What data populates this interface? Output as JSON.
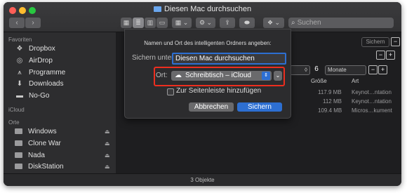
{
  "window": {
    "title": "Diesen Mac durchsuchen",
    "status": "3 Objekte"
  },
  "toolbar": {
    "back": "‹",
    "forward": "›",
    "view_icon": "▦",
    "view_list": "≣",
    "view_columns": "▥",
    "view_gallery": "▭",
    "group": "▦ ⌄",
    "action": "⚙ ⌄",
    "share": "⇪",
    "tag": "⬬",
    "dropbox": "❖ ⌄",
    "search_placeholder": "Suchen",
    "search_icon_glyph": "⌕"
  },
  "sidebar": {
    "favorites_heading": "Favoriten",
    "favorites": [
      {
        "label": "Dropbox",
        "icon": "dropbox-icon",
        "glyph": "❖"
      },
      {
        "label": "AirDrop",
        "icon": "airdrop-icon",
        "glyph": "◎"
      },
      {
        "label": "Programme",
        "icon": "applications-icon",
        "glyph": "⩚"
      },
      {
        "label": "Downloads",
        "icon": "downloads-icon",
        "glyph": "⬇"
      },
      {
        "label": "No-Go",
        "icon": "folder-icon",
        "glyph": "▬"
      }
    ],
    "icloud_heading": "iCloud",
    "orte_heading": "Orte",
    "orte": [
      {
        "label": "Windows",
        "icon": "disk-icon"
      },
      {
        "label": "Clone War",
        "icon": "disk-icon"
      },
      {
        "label": "Nada",
        "icon": "disk-icon"
      },
      {
        "label": "DiskStation",
        "icon": "server-icon"
      }
    ],
    "eject_glyph": "⏏"
  },
  "search_bar": {
    "save_button": "Sichern",
    "minus": "−",
    "plus": "+",
    "criteria_stepper_value": "6",
    "criteria_arrows": "◊",
    "criteria_unit": "Monate"
  },
  "table": {
    "columns": [
      "Größe",
      "Art"
    ],
    "rows": [
      {
        "size": "117.9 MB",
        "kind": "Keynot…ntation"
      },
      {
        "size": "112 MB",
        "kind": "Keynot…ntation"
      },
      {
        "size": "109.4 MB",
        "kind": "Micros…kument"
      }
    ]
  },
  "dialog": {
    "prompt": "Namen und Ort des intelligenten Ordners angeben:",
    "name_label": "Sichern unter:",
    "name_value": "Diesen Mac durchsuchen",
    "location_label": "Ort:",
    "location_value": "Schreibtisch – iCloud",
    "location_icon_glyph": "☁",
    "location_arrows_glyph": "⇕",
    "expand_glyph": "⌄",
    "sidebar_checkbox_label": "Zur Seitenleiste hinzufügen",
    "sidebar_checkbox_checked": false,
    "cancel_button": "Abbrechen",
    "save_button": "Sichern"
  },
  "colors": {
    "accent": "#2d6fd2",
    "highlight_box": "#ed2e1f"
  }
}
